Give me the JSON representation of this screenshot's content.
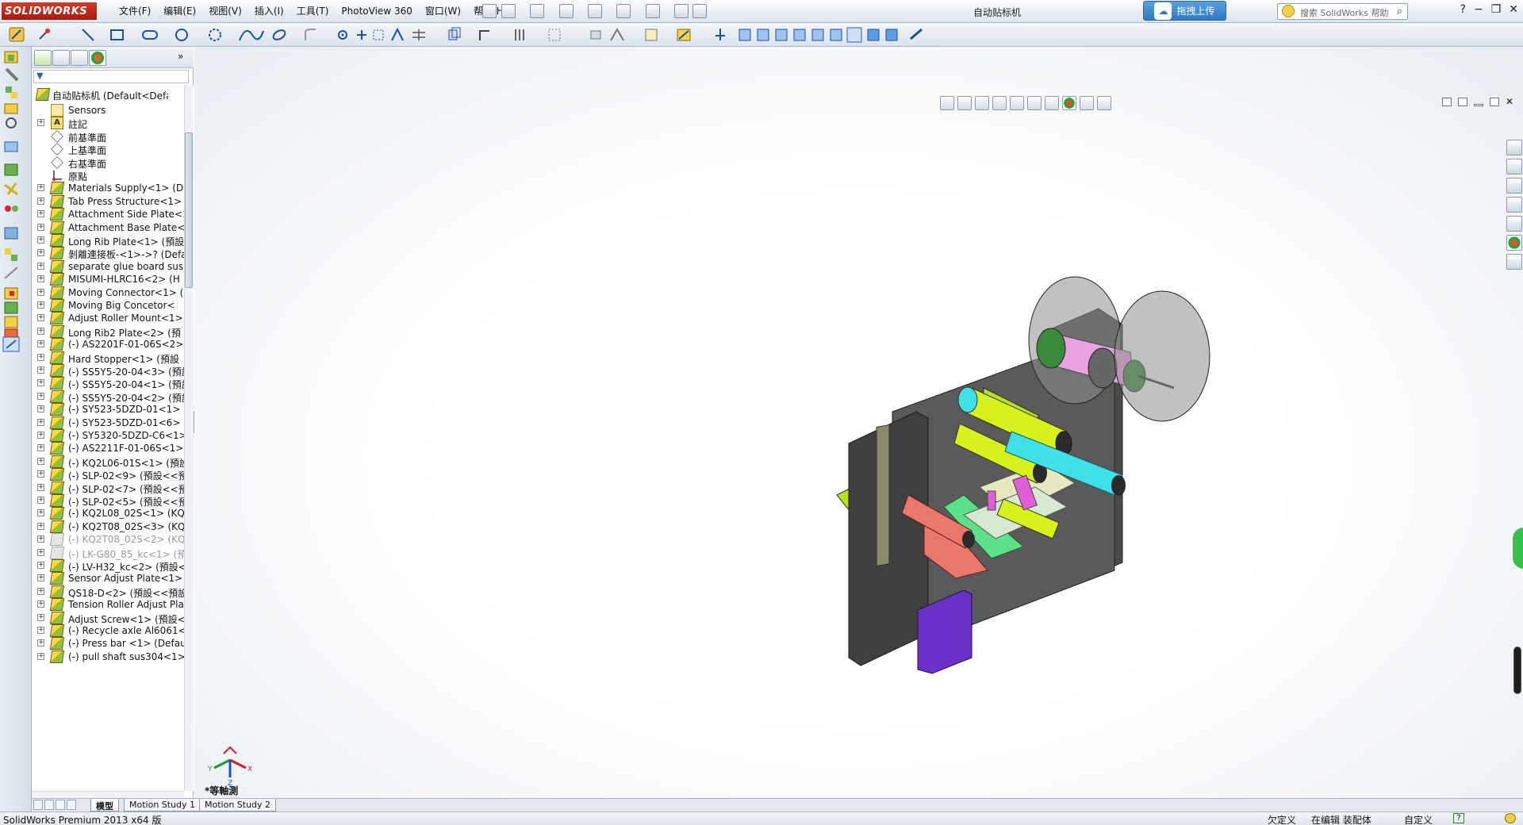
{
  "app": {
    "brand": "SOLIDWORKS",
    "window_title": "自动贴标机",
    "upload_label": "拖拽上传",
    "search_placeholder": "搜索 SolidWorks 帮助"
  },
  "menus": [
    "文件(F)",
    "编辑(E)",
    "视图(V)",
    "插入(I)",
    "工具(T)",
    "PhotoView 360",
    "窗口(W)",
    "帮助(H)"
  ],
  "feature_tree": {
    "root_label": "自动贴标机 (Default<Defaul",
    "items": [
      {
        "label": "Sensors",
        "icon": "sensor-icon",
        "expandable": false,
        "dim": false
      },
      {
        "label": "註記",
        "icon": "annotation-icon",
        "expandable": true,
        "dim": false
      },
      {
        "label": "前基準面",
        "icon": "plane-icon",
        "expandable": false,
        "dim": false
      },
      {
        "label": "上基準面",
        "icon": "plane-icon",
        "expandable": false,
        "dim": false
      },
      {
        "label": "右基準面",
        "icon": "plane-icon",
        "expandable": false,
        "dim": false
      },
      {
        "label": "原點",
        "icon": "origin-icon",
        "expandable": false,
        "dim": false
      },
      {
        "label": "Materials Supply<1> (De",
        "icon": "part-icon",
        "expandable": true,
        "dim": false
      },
      {
        "label": "Tab Press Structure<1>",
        "icon": "part-icon",
        "expandable": true,
        "dim": false
      },
      {
        "label": "Attachment Side Plate<1",
        "icon": "part-icon",
        "expandable": true,
        "dim": false
      },
      {
        "label": "Attachment Base Plate<1",
        "icon": "part-icon",
        "expandable": true,
        "dim": false
      },
      {
        "label": "Long Rib Plate<1> (預設",
        "icon": "part-icon",
        "expandable": true,
        "dim": false
      },
      {
        "label": "剝離連接板-<1>->? (Defa",
        "icon": "part-icon",
        "expandable": true,
        "dim": false
      },
      {
        "label": "separate glue board sus",
        "icon": "part-icon",
        "expandable": true,
        "dim": false
      },
      {
        "label": "MISUMI-HLRC16<2> (H",
        "icon": "part-icon",
        "expandable": true,
        "dim": false
      },
      {
        "label": "Moving Connector<1> (",
        "icon": "part-icon",
        "expandable": true,
        "dim": false
      },
      {
        "label": "Moving Big Concetor<",
        "icon": "part-icon",
        "expandable": true,
        "dim": false
      },
      {
        "label": "Adjust Roller Mount<1>",
        "icon": "part-icon",
        "expandable": true,
        "dim": false
      },
      {
        "label": "Long Rib2  Plate<2> (預",
        "icon": "part-icon",
        "expandable": true,
        "dim": false
      },
      {
        "label": "(-) AS2201F-01-06S<2>",
        "icon": "part-icon",
        "expandable": true,
        "dim": false
      },
      {
        "label": "Hard Stopper<1> (預設",
        "icon": "part-icon",
        "expandable": true,
        "dim": false
      },
      {
        "label": "(-) SS5Y5-20-04<3> (預設",
        "icon": "part-icon",
        "expandable": true,
        "dim": false
      },
      {
        "label": "(-) SS5Y5-20-04<1> (預設",
        "icon": "part-icon",
        "expandable": true,
        "dim": false
      },
      {
        "label": "(-) SS5Y5-20-04<2> (預設",
        "icon": "part-icon",
        "expandable": true,
        "dim": false
      },
      {
        "label": "(-) SY523-5DZD-01<1> (",
        "icon": "part-icon",
        "expandable": true,
        "dim": false
      },
      {
        "label": "(-) SY523-5DZD-01<6> (",
        "icon": "part-icon",
        "expandable": true,
        "dim": false
      },
      {
        "label": "(-) SY5320-5DZD-C6<1>",
        "icon": "part-icon",
        "expandable": true,
        "dim": false
      },
      {
        "label": "(-) AS2211F-01-06S<1>",
        "icon": "part-icon",
        "expandable": true,
        "dim": false
      },
      {
        "label": "(-) KQ2L06-01S<1> (預設",
        "icon": "part-icon",
        "expandable": true,
        "dim": false
      },
      {
        "label": "(-) SLP-02<9> (預設<<預",
        "icon": "part-icon",
        "expandable": true,
        "dim": false
      },
      {
        "label": "(-) SLP-02<7> (預設<<預",
        "icon": "part-icon",
        "expandable": true,
        "dim": false
      },
      {
        "label": "(-) SLP-02<5> (預設<<預",
        "icon": "part-icon",
        "expandable": true,
        "dim": false
      },
      {
        "label": "(-) KQ2L08_02S<1> (KQ",
        "icon": "part-icon",
        "expandable": true,
        "dim": false
      },
      {
        "label": "(-) KQ2T08_02S<3> (KQ",
        "icon": "part-icon",
        "expandable": true,
        "dim": false
      },
      {
        "label": "(-) KQ2T08_02S<2> (KQ",
        "icon": "part-icon",
        "expandable": true,
        "dim": true
      },
      {
        "label": "(-) LK-G80_85_kc<1> (預",
        "icon": "part-icon",
        "expandable": true,
        "dim": true
      },
      {
        "label": "(-) LV-H32_kc<2> (預設<",
        "icon": "part-icon",
        "expandable": true,
        "dim": false
      },
      {
        "label": "Sensor Adjust Plate<1>",
        "icon": "part-icon",
        "expandable": true,
        "dim": false
      },
      {
        "label": "QS18-D<2> (預設<<預設",
        "icon": "part-icon",
        "expandable": true,
        "dim": false
      },
      {
        "label": "Tension Roller Adjust Pla",
        "icon": "part-icon",
        "expandable": true,
        "dim": false
      },
      {
        "label": "Adjust Screw<1> (預設<",
        "icon": "part-icon",
        "expandable": true,
        "dim": false
      },
      {
        "label": "(-) Recycle axle Al6061<",
        "icon": "part-icon",
        "expandable": true,
        "dim": false
      },
      {
        "label": "(-) Press bar <1> (Defau",
        "icon": "part-icon",
        "expandable": true,
        "dim": false
      },
      {
        "label": "(-) pull shaft sus304<1>",
        "icon": "part-icon",
        "expandable": true,
        "dim": false
      }
    ]
  },
  "viewport": {
    "view_label": "*等軸測",
    "triad": {
      "x": "X",
      "y": "Y",
      "z": "Z"
    }
  },
  "bottom_tabs": [
    "模型",
    "Motion Study 1",
    "Motion Study 2"
  ],
  "status": {
    "product": "SolidWorks Premium 2013 x64 版",
    "state1": "欠定义",
    "state2": "在编辑 装配体",
    "state3": "自定义"
  },
  "colors": {
    "model_frame": "#4a4a4a",
    "model_green": "#b7e21f",
    "model_cyan": "#3fe0e8",
    "model_magenta": "#e05ed6",
    "model_purple": "#6a30c8",
    "model_salmon": "#e9776b"
  }
}
